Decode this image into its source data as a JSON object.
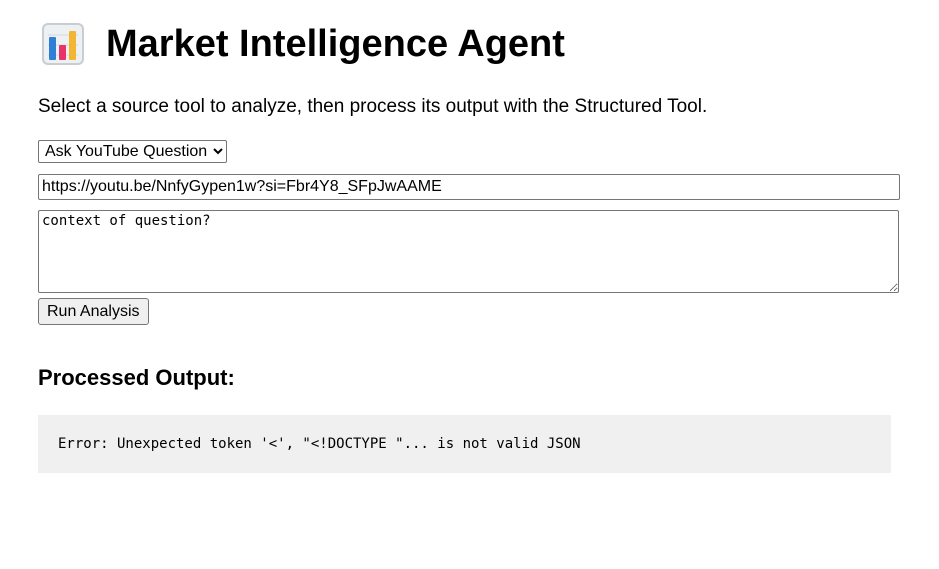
{
  "header": {
    "icon": "bar-chart-icon",
    "title": "Market Intelligence Agent"
  },
  "description": "Select a source tool to analyze, then process its output with the Structured Tool.",
  "form": {
    "tool_select": {
      "selected": "Ask YouTube Question",
      "options": [
        "Ask YouTube Question"
      ]
    },
    "url_input": {
      "value": "https://youtu.be/NnfyGypen1w?si=Fbr4Y8_SFpJwAAME"
    },
    "question_input": {
      "value": "context of question?"
    },
    "run_button_label": "Run Analysis"
  },
  "output": {
    "heading": "Processed Output:",
    "text": "Error: Unexpected token '<', \"<!DOCTYPE \"... is not valid JSON"
  },
  "colors": {
    "output_background": "#f0f0f0",
    "chart_icon_frame": "#c8cdd2",
    "chart_icon_bar_blue": "#2f7fd6",
    "chart_icon_bar_red": "#e8336b",
    "chart_icon_bar_yellow": "#f2b632"
  }
}
